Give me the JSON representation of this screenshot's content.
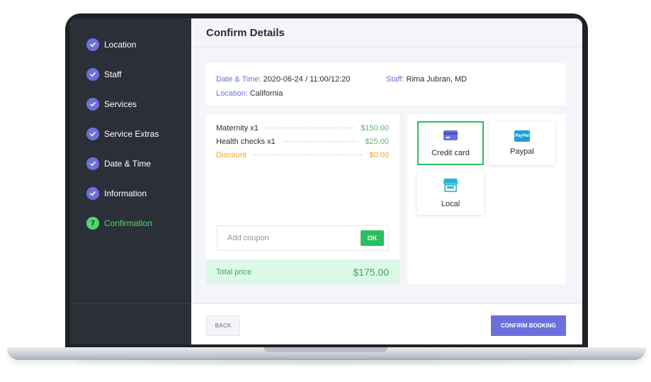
{
  "sidebar": {
    "steps": [
      {
        "label": "Location",
        "state": "done"
      },
      {
        "label": "Staff",
        "state": "done"
      },
      {
        "label": "Services",
        "state": "done"
      },
      {
        "label": "Service Extras",
        "state": "done"
      },
      {
        "label": "Date & Time",
        "state": "done"
      },
      {
        "label": "Information",
        "state": "done"
      },
      {
        "label": "Confirmation",
        "state": "active",
        "number": "7"
      }
    ]
  },
  "header": {
    "title": "Confirm Details"
  },
  "summary": {
    "datetime_label": "Date & Time:",
    "datetime_value": "2020-06-24 / 11:00/12:20",
    "staff_label": "Staff:",
    "staff_value": "Rima Jubran, MD",
    "location_label": "Location:",
    "location_value": "California"
  },
  "prices": {
    "items": [
      {
        "name": "Maternity x1",
        "value": "$150.00"
      },
      {
        "name": "Health checks x1",
        "value": "$25.00"
      }
    ],
    "discount": {
      "name": "Discount",
      "value": "$0.00"
    },
    "coupon_placeholder": "Add coupon",
    "coupon_value": "",
    "ok_label": "OK",
    "total_label": "Total price",
    "total_value": "$175.00"
  },
  "payments": {
    "credit_card": "Credit card",
    "paypal": "Paypal",
    "paypal_logo_text": "PayPal",
    "local": "Local",
    "selected": "credit_card"
  },
  "footer": {
    "back_label": "BACK",
    "confirm_label": "CONFIRM BOOKING"
  },
  "colors": {
    "accent": "#6c70dc",
    "success": "#2ac05f",
    "discount": "#f5a623",
    "sidebar_bg": "#2b3038"
  }
}
